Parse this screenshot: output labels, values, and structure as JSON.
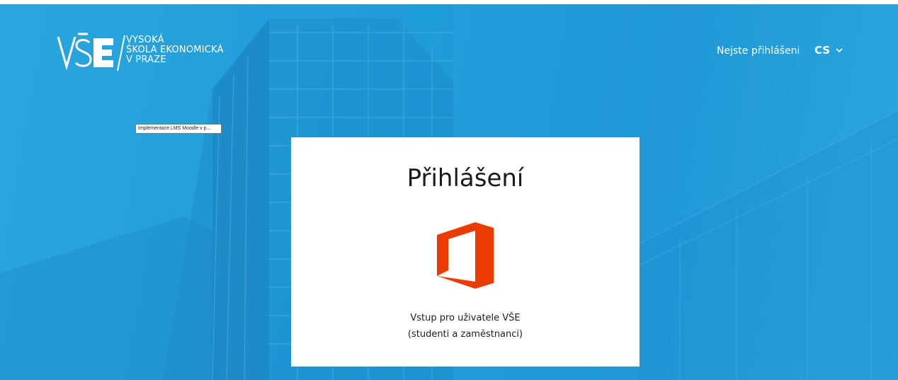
{
  "header": {
    "logo": {
      "mark_text": "VŠE",
      "line1": "VYSOKÁ",
      "line2": "ŠKOLA EKONOMICKÁ",
      "line3": "V PRAZE"
    },
    "user_status": "Nejste přihlášeni",
    "language": "CS"
  },
  "tooltip": "Implementace LMS Moodle v p...",
  "login_card": {
    "title": "Přihlášení",
    "caption_line1": "Vstup pro uživatele VŠE",
    "caption_line2": "(studenti a zaměstnanci)",
    "provider_icon": "microsoft-office-icon"
  },
  "colors": {
    "hero_blue": "#1e9bd9",
    "office_orange": "#eb3c00",
    "card_bg": "#ffffff"
  }
}
